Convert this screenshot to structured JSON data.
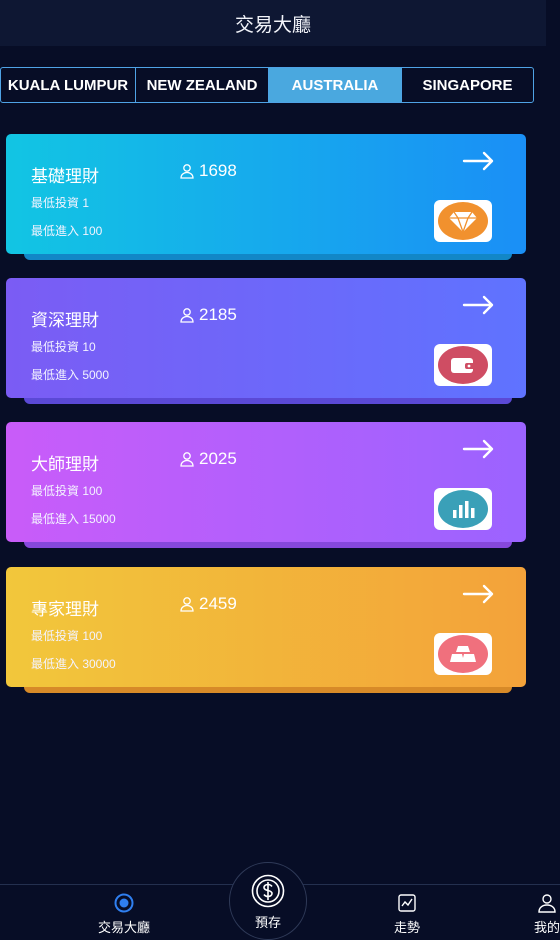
{
  "header": {
    "title": "交易大廳"
  },
  "tabs": [
    {
      "label": "KUALA LUMPUR",
      "active": false
    },
    {
      "label": "NEW ZEALAND",
      "active": false
    },
    {
      "label": "AUSTRALIA",
      "active": true
    },
    {
      "label": "SINGAPORE",
      "active": false
    }
  ],
  "cards": [
    {
      "title": "基礎理財",
      "users": "1698",
      "line1": "最低投資 1",
      "line2": "最低進入 100",
      "icon": "diamond-icon",
      "icon_color": "#f1912e"
    },
    {
      "title": "資深理財",
      "users": "2185",
      "line1": "最低投資 10",
      "line2": "最低進入 5000",
      "icon": "wallet-icon",
      "icon_color": "#cf4d63"
    },
    {
      "title": "大師理財",
      "users": "2025",
      "line1": "最低投資 100",
      "line2": "最低進入 15000",
      "icon": "bar-chart-icon",
      "icon_color": "#3aa0b8"
    },
    {
      "title": "專家理財",
      "users": "2459",
      "line1": "最低投資 100",
      "line2": "最低進入 30000",
      "icon": "gold-bars-icon",
      "icon_color": "#f0707d"
    }
  ],
  "nav": {
    "trading_hall": "交易大廳",
    "deposit": "預存",
    "trend": "走勢",
    "mine": "我的"
  },
  "colors": {
    "accent": "#4aa8df",
    "background": "#070d26",
    "nav_active": "#2f7ff0"
  }
}
